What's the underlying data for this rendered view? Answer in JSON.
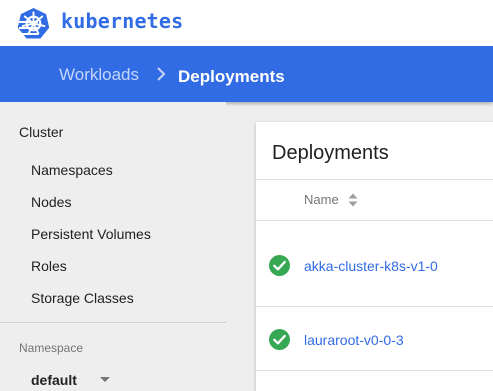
{
  "app": {
    "brand": "kubernetes",
    "logo_icon": "kubernetes-helm-icon",
    "colors": {
      "primary": "#326ce5",
      "success": "#36a853",
      "text": "#212121"
    }
  },
  "breadcrumb": {
    "parent": "Workloads",
    "separator_icon": "chevron-right-icon",
    "current": "Deployments"
  },
  "sidebar": {
    "section_title": "Cluster",
    "items": [
      {
        "label": "Namespaces"
      },
      {
        "label": "Nodes"
      },
      {
        "label": "Persistent Volumes"
      },
      {
        "label": "Roles"
      },
      {
        "label": "Storage Classes"
      }
    ],
    "namespace": {
      "label": "Namespace",
      "value": "default"
    }
  },
  "main": {
    "card_title": "Deployments",
    "columns": [
      {
        "label": "Name",
        "icon": "sort-icon"
      }
    ],
    "rows": [
      {
        "status": "success",
        "status_icon": "check-circle-icon",
        "name": "akka-cluster-k8s-v1-0"
      },
      {
        "status": "success",
        "status_icon": "check-circle-icon",
        "name": "lauraroot-v0-0-3"
      }
    ]
  }
}
